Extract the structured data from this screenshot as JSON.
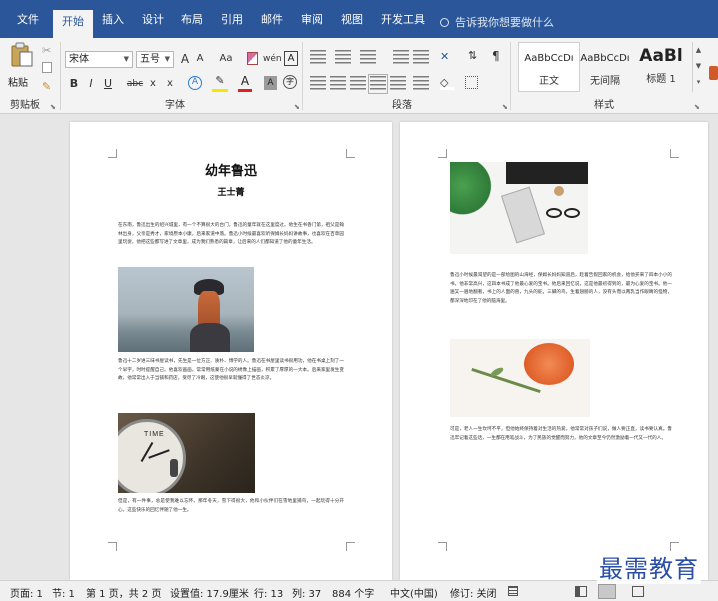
{
  "tabs": [
    "文件",
    "开始",
    "插入",
    "设计",
    "布局",
    "引用",
    "邮件",
    "审阅",
    "视图",
    "开发工具"
  ],
  "tell_me": "告诉我你想要做什么",
  "ribbon": {
    "clipboard": {
      "paste": "粘贴",
      "label": "剪贴板"
    },
    "font": {
      "name": "宋体",
      "size": "五号",
      "grow": "A",
      "shrink": "A",
      "case": "Aa",
      "phonetic": "wén",
      "bold": "B",
      "italic": "I",
      "underline": "U",
      "strike": "abc",
      "sub": "x",
      "sup": "x",
      "label": "字体"
    },
    "paragraph": {
      "label": "段落"
    },
    "styles": {
      "items": [
        {
          "preview": "AaBbCcDı",
          "name": "正文"
        },
        {
          "preview": "AaBbCcDı",
          "name": "无间隔"
        },
        {
          "preview": "AaBl",
          "name": "标题 1"
        }
      ],
      "label": "样式"
    }
  },
  "doc": {
    "title": "幼年鲁迅",
    "author": "王士菁",
    "p1": "在东南，鲁迅出生的绍兴城里，有一个不算很大的台门，鲁迅的童年就在这里度过。他生在书香门第，祖父是翰林出身，父亲是秀才，家境原本小康，后来家道中落。鲁迅小时候最喜欢听保姆长妈妈讲故事，也喜欢在百草园里玩耍，他把这些都写进了文章里，成为我们熟悉的篇章，让后来的人们都知道了他的童年生活。",
    "p2": "鲁迅十二岁进三味书屋读书，先生是一位方正、质朴、博学的人。鲁迅在书屋里读书很用功，他在书桌上刻了一个早字，时时提醒自己。他喜欢画画，常常用纸蒙在小说的绣像上描画，积累了厚厚的一大本。后来家里发生变故，他常常出入于当铺和药店，受尽了冷眼，这使他很早就懂得了世态炎凉。",
    "p3": "但是，有一件事，总是使我难以忘怀。那年冬天，雪下得很大，他和小伙伴们在雪地里捕鸟，一起玩得十分开心，这些快乐的回忆伴随了他一生。",
    "p4": "鲁迅小时候最渴望的是一部绘图的山海经，保姆长妈妈知道后，趁着告假回家的机会，给他买来了四本小小的书，他非常高兴，这四本书成了他最心爱的宝书。他后来回忆说，这是他最初得到的，最为心爱的宝书。他一遍又一遍地翻看，书上的人面的兽，九头的蛇，三脚的鸟，生着翅膀的人，没有头而以两乳当作眼睛的怪物，都深深地印在了他的脑海里。",
    "p5": "可是，老人一生坎坷不平，但他始终保持着对生活的热爱。他常常对孩子们说，做人要正直，读书要认真。鲁迅牢记着这些话，一生都在用笔战斗，为了民族的觉醒而努力，他的文章至今仍然激励着一代又一代的人。"
  },
  "status": {
    "page": "页面: 1",
    "section": "节: 1",
    "pages": "第 1 页，共 2 页",
    "pos": "设置值: 17.9厘米",
    "row": "行: 13",
    "col": "列: 37",
    "words": "884 个字",
    "lang": "中文(中国)",
    "track": "修订: 关闭"
  },
  "watermark": "最需教育",
  "colors": {
    "accent": "#2b579a",
    "ribbon": "#f3f3f3",
    "workspace": "#e6e6e6"
  }
}
